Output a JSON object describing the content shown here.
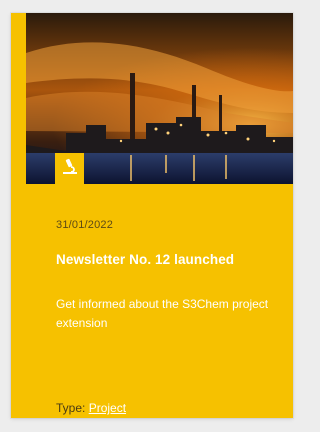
{
  "card": {
    "date": "31/01/2022",
    "title": "Newsletter No. 12 launched",
    "summary": "Get informed about the S3Chem project extension",
    "type_label": "Type:",
    "type_value": "Project",
    "badge_icon": "microscope-icon",
    "accent_color": "#f6c100"
  }
}
